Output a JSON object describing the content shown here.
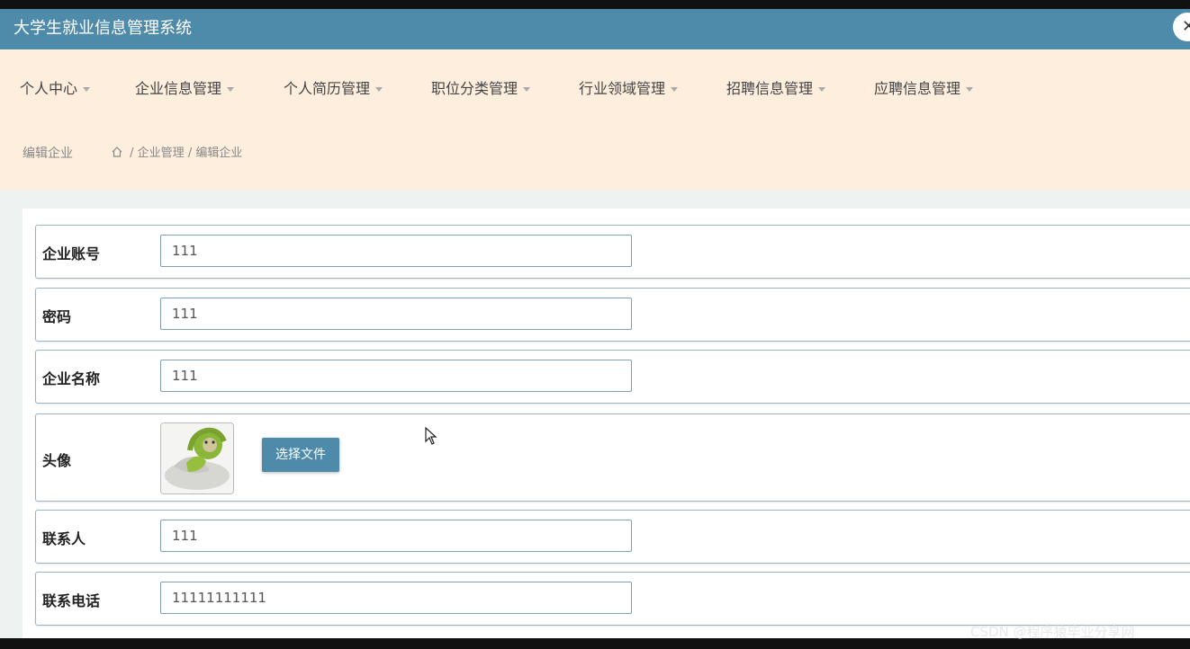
{
  "app": {
    "title": "大学生就业信息管理系统",
    "close_glyph": "✕"
  },
  "nav": {
    "items": [
      {
        "label": "个人中心"
      },
      {
        "label": "企业信息管理"
      },
      {
        "label": "个人简历管理"
      },
      {
        "label": "职位分类管理"
      },
      {
        "label": "行业领域管理"
      },
      {
        "label": "招聘信息管理"
      },
      {
        "label": "应聘信息管理"
      }
    ]
  },
  "page": {
    "heading": "编辑企业",
    "breadcrumb": {
      "section": "企业管理",
      "separator": "/",
      "current": "编辑企业"
    }
  },
  "form": {
    "account": {
      "label": "企业账号",
      "value": "111"
    },
    "password": {
      "label": "密码",
      "value": "111"
    },
    "company_name": {
      "label": "企业名称",
      "value": "111"
    },
    "avatar": {
      "label": "头像",
      "button": "选择文件"
    },
    "contact": {
      "label": "联系人",
      "value": "111"
    },
    "phone": {
      "label": "联系电话",
      "value": "11111111111"
    }
  },
  "watermark": "CSDN @程序猿毕业分享网",
  "colors": {
    "primary": "#4e8aa9",
    "nav_bg": "#fdeedd",
    "border": "#9db3c4"
  },
  "icons": {
    "close": "close-icon",
    "home": "home-icon",
    "dropdown": "caret-down-icon"
  }
}
